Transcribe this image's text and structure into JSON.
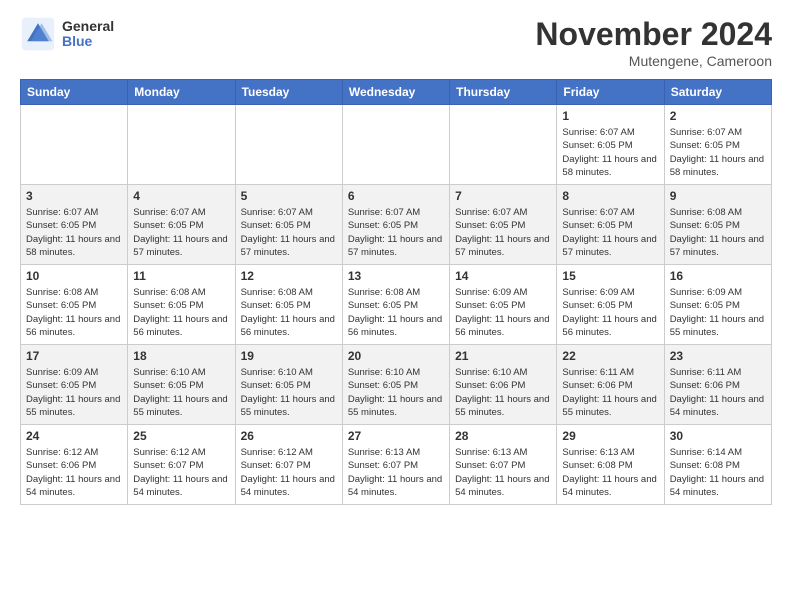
{
  "logo": {
    "general": "General",
    "blue": "Blue"
  },
  "title": "November 2024",
  "location": "Mutengene, Cameroon",
  "weekdays": [
    "Sunday",
    "Monday",
    "Tuesday",
    "Wednesday",
    "Thursday",
    "Friday",
    "Saturday"
  ],
  "weeks": [
    [
      {
        "day": "",
        "sunrise": "",
        "sunset": "",
        "daylight": ""
      },
      {
        "day": "",
        "sunrise": "",
        "sunset": "",
        "daylight": ""
      },
      {
        "day": "",
        "sunrise": "",
        "sunset": "",
        "daylight": ""
      },
      {
        "day": "",
        "sunrise": "",
        "sunset": "",
        "daylight": ""
      },
      {
        "day": "",
        "sunrise": "",
        "sunset": "",
        "daylight": ""
      },
      {
        "day": "1",
        "sunrise": "Sunrise: 6:07 AM",
        "sunset": "Sunset: 6:05 PM",
        "daylight": "Daylight: 11 hours and 58 minutes."
      },
      {
        "day": "2",
        "sunrise": "Sunrise: 6:07 AM",
        "sunset": "Sunset: 6:05 PM",
        "daylight": "Daylight: 11 hours and 58 minutes."
      }
    ],
    [
      {
        "day": "3",
        "sunrise": "Sunrise: 6:07 AM",
        "sunset": "Sunset: 6:05 PM",
        "daylight": "Daylight: 11 hours and 58 minutes."
      },
      {
        "day": "4",
        "sunrise": "Sunrise: 6:07 AM",
        "sunset": "Sunset: 6:05 PM",
        "daylight": "Daylight: 11 hours and 57 minutes."
      },
      {
        "day": "5",
        "sunrise": "Sunrise: 6:07 AM",
        "sunset": "Sunset: 6:05 PM",
        "daylight": "Daylight: 11 hours and 57 minutes."
      },
      {
        "day": "6",
        "sunrise": "Sunrise: 6:07 AM",
        "sunset": "Sunset: 6:05 PM",
        "daylight": "Daylight: 11 hours and 57 minutes."
      },
      {
        "day": "7",
        "sunrise": "Sunrise: 6:07 AM",
        "sunset": "Sunset: 6:05 PM",
        "daylight": "Daylight: 11 hours and 57 minutes."
      },
      {
        "day": "8",
        "sunrise": "Sunrise: 6:07 AM",
        "sunset": "Sunset: 6:05 PM",
        "daylight": "Daylight: 11 hours and 57 minutes."
      },
      {
        "day": "9",
        "sunrise": "Sunrise: 6:08 AM",
        "sunset": "Sunset: 6:05 PM",
        "daylight": "Daylight: 11 hours and 57 minutes."
      }
    ],
    [
      {
        "day": "10",
        "sunrise": "Sunrise: 6:08 AM",
        "sunset": "Sunset: 6:05 PM",
        "daylight": "Daylight: 11 hours and 56 minutes."
      },
      {
        "day": "11",
        "sunrise": "Sunrise: 6:08 AM",
        "sunset": "Sunset: 6:05 PM",
        "daylight": "Daylight: 11 hours and 56 minutes."
      },
      {
        "day": "12",
        "sunrise": "Sunrise: 6:08 AM",
        "sunset": "Sunset: 6:05 PM",
        "daylight": "Daylight: 11 hours and 56 minutes."
      },
      {
        "day": "13",
        "sunrise": "Sunrise: 6:08 AM",
        "sunset": "Sunset: 6:05 PM",
        "daylight": "Daylight: 11 hours and 56 minutes."
      },
      {
        "day": "14",
        "sunrise": "Sunrise: 6:09 AM",
        "sunset": "Sunset: 6:05 PM",
        "daylight": "Daylight: 11 hours and 56 minutes."
      },
      {
        "day": "15",
        "sunrise": "Sunrise: 6:09 AM",
        "sunset": "Sunset: 6:05 PM",
        "daylight": "Daylight: 11 hours and 56 minutes."
      },
      {
        "day": "16",
        "sunrise": "Sunrise: 6:09 AM",
        "sunset": "Sunset: 6:05 PM",
        "daylight": "Daylight: 11 hours and 55 minutes."
      }
    ],
    [
      {
        "day": "17",
        "sunrise": "Sunrise: 6:09 AM",
        "sunset": "Sunset: 6:05 PM",
        "daylight": "Daylight: 11 hours and 55 minutes."
      },
      {
        "day": "18",
        "sunrise": "Sunrise: 6:10 AM",
        "sunset": "Sunset: 6:05 PM",
        "daylight": "Daylight: 11 hours and 55 minutes."
      },
      {
        "day": "19",
        "sunrise": "Sunrise: 6:10 AM",
        "sunset": "Sunset: 6:05 PM",
        "daylight": "Daylight: 11 hours and 55 minutes."
      },
      {
        "day": "20",
        "sunrise": "Sunrise: 6:10 AM",
        "sunset": "Sunset: 6:05 PM",
        "daylight": "Daylight: 11 hours and 55 minutes."
      },
      {
        "day": "21",
        "sunrise": "Sunrise: 6:10 AM",
        "sunset": "Sunset: 6:06 PM",
        "daylight": "Daylight: 11 hours and 55 minutes."
      },
      {
        "day": "22",
        "sunrise": "Sunrise: 6:11 AM",
        "sunset": "Sunset: 6:06 PM",
        "daylight": "Daylight: 11 hours and 55 minutes."
      },
      {
        "day": "23",
        "sunrise": "Sunrise: 6:11 AM",
        "sunset": "Sunset: 6:06 PM",
        "daylight": "Daylight: 11 hours and 54 minutes."
      }
    ],
    [
      {
        "day": "24",
        "sunrise": "Sunrise: 6:12 AM",
        "sunset": "Sunset: 6:06 PM",
        "daylight": "Daylight: 11 hours and 54 minutes."
      },
      {
        "day": "25",
        "sunrise": "Sunrise: 6:12 AM",
        "sunset": "Sunset: 6:07 PM",
        "daylight": "Daylight: 11 hours and 54 minutes."
      },
      {
        "day": "26",
        "sunrise": "Sunrise: 6:12 AM",
        "sunset": "Sunset: 6:07 PM",
        "daylight": "Daylight: 11 hours and 54 minutes."
      },
      {
        "day": "27",
        "sunrise": "Sunrise: 6:13 AM",
        "sunset": "Sunset: 6:07 PM",
        "daylight": "Daylight: 11 hours and 54 minutes."
      },
      {
        "day": "28",
        "sunrise": "Sunrise: 6:13 AM",
        "sunset": "Sunset: 6:07 PM",
        "daylight": "Daylight: 11 hours and 54 minutes."
      },
      {
        "day": "29",
        "sunrise": "Sunrise: 6:13 AM",
        "sunset": "Sunset: 6:08 PM",
        "daylight": "Daylight: 11 hours and 54 minutes."
      },
      {
        "day": "30",
        "sunrise": "Sunrise: 6:14 AM",
        "sunset": "Sunset: 6:08 PM",
        "daylight": "Daylight: 11 hours and 54 minutes."
      }
    ]
  ]
}
